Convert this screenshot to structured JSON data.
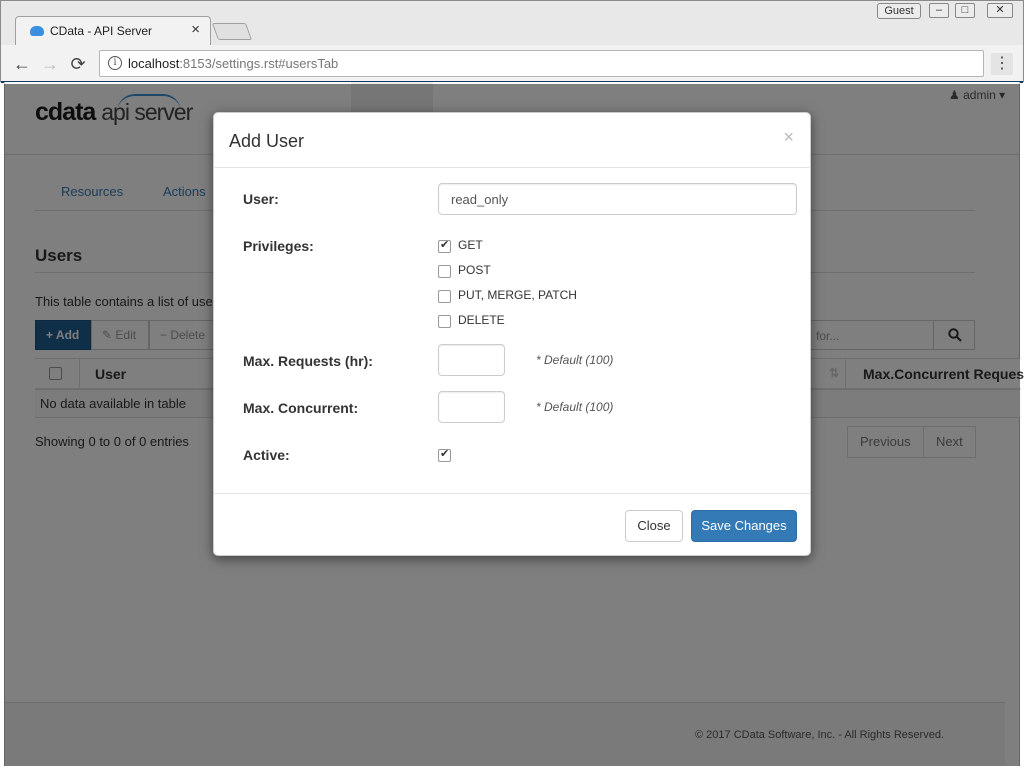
{
  "browser": {
    "tab_title": "CData - API Server",
    "tab_close": "×",
    "profile": "Guest",
    "url_host": "localhost",
    "url_rest": ":8153/settings.rst#usersTab",
    "win_min": "–",
    "win_max": "□",
    "win_close": "✕",
    "back": "←",
    "forward": "→",
    "reload": "⟳",
    "info": "i",
    "menu": "⋮"
  },
  "app": {
    "logo_c": "cdata",
    "logo_api": "api server",
    "user_menu": "admin",
    "user_icon": "user-icon",
    "nav_tabs": [
      "Resources",
      "Actions"
    ],
    "section_title": "Users",
    "section_desc": "This table contains a list of user",
    "toolbar": {
      "add": "+ Add",
      "edit": "Edit",
      "delete": "− Delete"
    },
    "search_placeholder": "for...",
    "table_headers": [
      "User",
      "Max.Concurrent Requests"
    ],
    "empty_message": "No data available in table",
    "showing": "Showing 0 to 0 of 0 entries",
    "pager": {
      "previous": "Previous",
      "next": "Next"
    },
    "footer": "© 2017 CData Software, Inc. - All Rights Reserved."
  },
  "modal": {
    "title": "Add User",
    "close_x": "×",
    "user_label": "User:",
    "user_value": "read_only",
    "privileges_label": "Privileges:",
    "privileges": [
      {
        "label": "GET",
        "checked": true
      },
      {
        "label": "POST",
        "checked": false
      },
      {
        "label": "PUT, MERGE, PATCH",
        "checked": false
      },
      {
        "label": "DELETE",
        "checked": false
      }
    ],
    "max_requests_label": "Max. Requests (hr):",
    "max_requests_value": "",
    "max_requests_hint": "* Default (100)",
    "max_concurrent_label": "Max. Concurrent:",
    "max_concurrent_value": "",
    "max_concurrent_hint": "* Default (100)",
    "active_label": "Active:",
    "active_checked": true,
    "close_button": "Close",
    "save_button": "Save Changes"
  },
  "colors": {
    "primary": "#337ab7",
    "dark_primary": "#1f5f93",
    "link": "#337ab7",
    "overlay": "rgba(0,0,0,0.5)"
  }
}
